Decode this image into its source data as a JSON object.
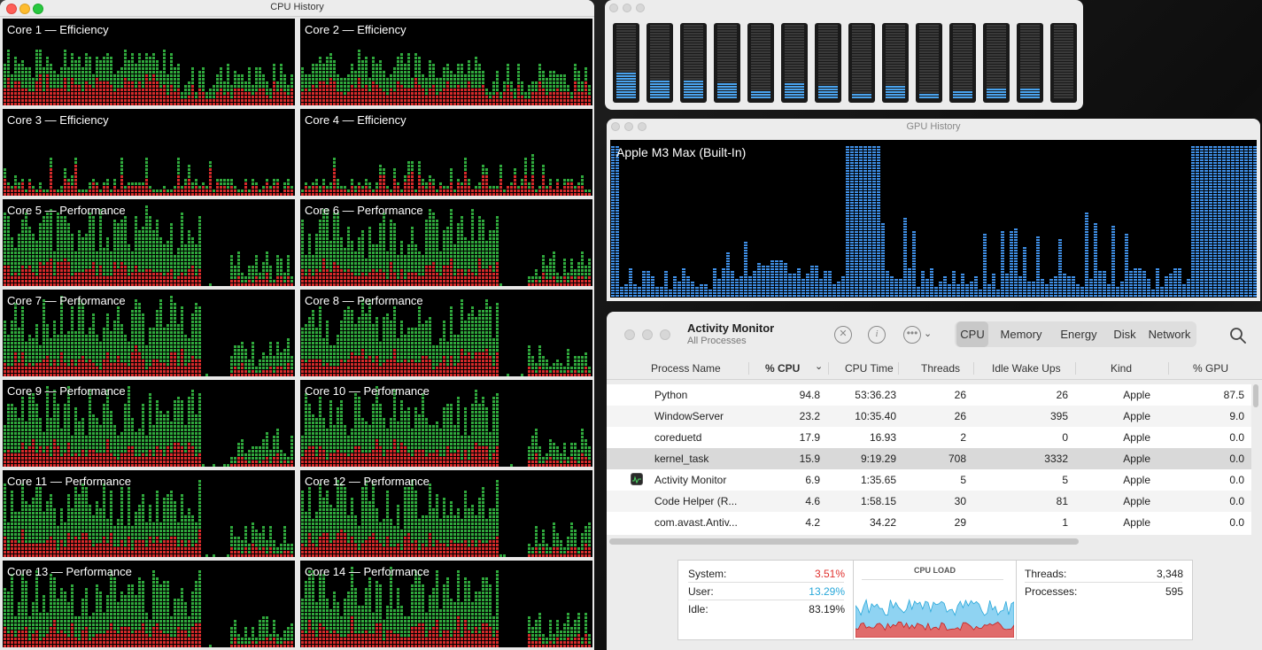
{
  "cpu_history": {
    "title": "CPU History",
    "cores": [
      {
        "label": "Core 1 — Efficiency",
        "type": "efficiency",
        "seed": 1
      },
      {
        "label": "Core 2 — Efficiency",
        "type": "efficiency",
        "seed": 2
      },
      {
        "label": "Core 3 — Efficiency",
        "type": "efficiency-low",
        "seed": 3
      },
      {
        "label": "Core 4 — Efficiency",
        "type": "efficiency-low",
        "seed": 4
      },
      {
        "label": "Core 5 — Performance",
        "type": "performance",
        "seed": 5
      },
      {
        "label": "Core 6 — Performance",
        "type": "performance",
        "seed": 6
      },
      {
        "label": "Core 7 — Performance",
        "type": "performance",
        "seed": 7
      },
      {
        "label": "Core 8 — Performance",
        "type": "performance",
        "seed": 8
      },
      {
        "label": "Core 9 — Performance",
        "type": "performance",
        "seed": 9
      },
      {
        "label": "Core 10 — Performance",
        "type": "performance",
        "seed": 10
      },
      {
        "label": "Core 11 — Performance",
        "type": "performance",
        "seed": 11
      },
      {
        "label": "Core 12 — Performance",
        "type": "performance",
        "seed": 12
      },
      {
        "label": "Core 13 — Performance",
        "type": "performance",
        "seed": 13
      },
      {
        "label": "Core 14 — Performance",
        "type": "performance",
        "seed": 14
      }
    ],
    "colors": {
      "user": "#2fa83c",
      "system": "#d42a2a"
    }
  },
  "cpu_meters": {
    "levels": [
      0.36,
      0.24,
      0.24,
      0.2,
      0.1,
      0.22,
      0.18,
      0.06,
      0.18,
      0.06,
      0.12,
      0.14,
      0.14,
      0.0
    ],
    "color": "#4aa3ee"
  },
  "gpu_history": {
    "title": "GPU History",
    "gpu_name": "Apple M3 Max (Built-In)",
    "color": "#3f8fe6"
  },
  "activity_monitor": {
    "title": "Activity Monitor",
    "subtitle": "All Processes",
    "tabs": [
      "CPU",
      "Memory",
      "Energy",
      "Disk",
      "Network"
    ],
    "active_tab": "CPU",
    "columns": [
      "Process Name",
      "% CPU",
      "CPU Time",
      "Threads",
      "Idle Wake Ups",
      "Kind",
      "% GPU"
    ],
    "rows": [
      {
        "name": "Python",
        "cpu": "94.8",
        "time": "53:36.23",
        "threads": "26",
        "wake": "26",
        "kind": "Apple",
        "gpu": "87.5"
      },
      {
        "name": "WindowServer",
        "cpu": "23.2",
        "time": "10:35.40",
        "threads": "26",
        "wake": "395",
        "kind": "Apple",
        "gpu": "9.0"
      },
      {
        "name": "coreduetd",
        "cpu": "17.9",
        "time": "16.93",
        "threads": "2",
        "wake": "0",
        "kind": "Apple",
        "gpu": "0.0"
      },
      {
        "name": "kernel_task",
        "cpu": "15.9",
        "time": "9:19.29",
        "threads": "708",
        "wake": "3332",
        "kind": "Apple",
        "gpu": "0.0"
      },
      {
        "name": "Activity Monitor",
        "cpu": "6.9",
        "time": "1:35.65",
        "threads": "5",
        "wake": "5",
        "kind": "Apple",
        "gpu": "0.0"
      },
      {
        "name": "Code Helper (R...",
        "cpu": "4.6",
        "time": "1:58.15",
        "threads": "30",
        "wake": "81",
        "kind": "Apple",
        "gpu": "0.0"
      },
      {
        "name": "com.avast.Antiv...",
        "cpu": "4.2",
        "time": "34.22",
        "threads": "29",
        "wake": "1",
        "kind": "Apple",
        "gpu": "0.0"
      }
    ],
    "summary": {
      "system_label": "System:",
      "system_value": "3.51%",
      "user_label": "User:",
      "user_value": "13.29%",
      "idle_label": "Idle:",
      "idle_value": "83.19%",
      "load_title": "CPU LOAD",
      "threads_label": "Threads:",
      "threads_value": "3,348",
      "processes_label": "Processes:",
      "processes_value": "595",
      "system_color": "#e0302d",
      "user_color": "#28a7d9"
    }
  }
}
